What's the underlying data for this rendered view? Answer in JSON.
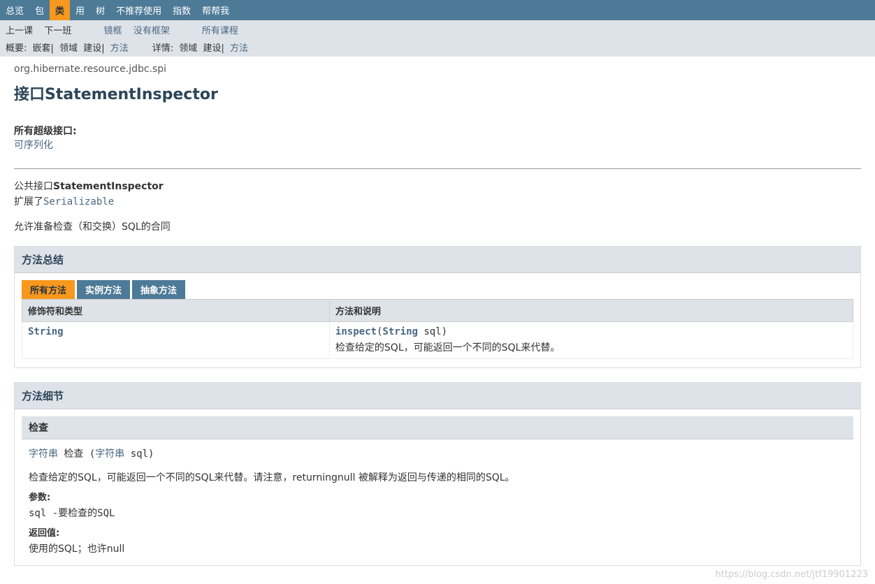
{
  "topnav": {
    "items": [
      {
        "label": "总览"
      },
      {
        "label": "包"
      },
      {
        "label": "类",
        "active": true
      },
      {
        "label": "用"
      },
      {
        "label": "树"
      },
      {
        "label": "不推荐使用"
      },
      {
        "label": "指数"
      },
      {
        "label": "帮帮我"
      }
    ]
  },
  "subnav": {
    "prev": "上一课",
    "next": "下一班",
    "frames": "镜框",
    "noframes": "没有框架",
    "allclasses": "所有课程",
    "summary_label": "概要:",
    "summary_items": {
      "nested": "嵌套|",
      "field": "领域",
      "constr": "建设|",
      "method": "方法"
    },
    "detail_label": "详情:",
    "detail_items": {
      "field": "领域",
      "constr": "建设|",
      "method": "方法"
    }
  },
  "header": {
    "package": "org.hibernate.resource.jdbc.spi",
    "title": "接口StatementInspector"
  },
  "superinterfaces": {
    "label": "所有超级接口:",
    "link": "可序列化"
  },
  "signature": {
    "prefix": "公共接口",
    "name": "StatementInspector",
    "extends_label": "扩展了",
    "extends_link": "Serializable"
  },
  "description": "允许准备检查（和交换）SQL的合同",
  "method_summary": {
    "heading": "方法总结",
    "tabs": [
      {
        "label": "所有方法",
        "active": true
      },
      {
        "label": "实例方法"
      },
      {
        "label": "抽象方法"
      }
    ],
    "col_type": "修饰符和类型",
    "col_method": "方法和说明",
    "rows": [
      {
        "type_link": "String",
        "method_link": "inspect",
        "open": "(",
        "param_type": "String",
        "param_name": " sql)",
        "desc": "检查给定的SQL，可能返回一个不同的SQL来代替。"
      }
    ]
  },
  "method_detail": {
    "heading": "方法细节",
    "method_name": "检查",
    "sig_type": "字符串",
    "sig_name": " 检查 (",
    "sig_param_type": "字符串",
    "sig_param_name": " sql)",
    "desc": "检查给定的SQL，可能返回一个不同的SQL来代替。请注意，returningnull 被解释为返回与传递的相同的SQL。",
    "params_label": "参数:",
    "params_value": "sql  -要检查的SQL",
    "returns_label": "返回值:",
    "returns_value": "使用的SQL；也许null"
  },
  "watermark": "https://blog.csdn.net/jtf19901223"
}
